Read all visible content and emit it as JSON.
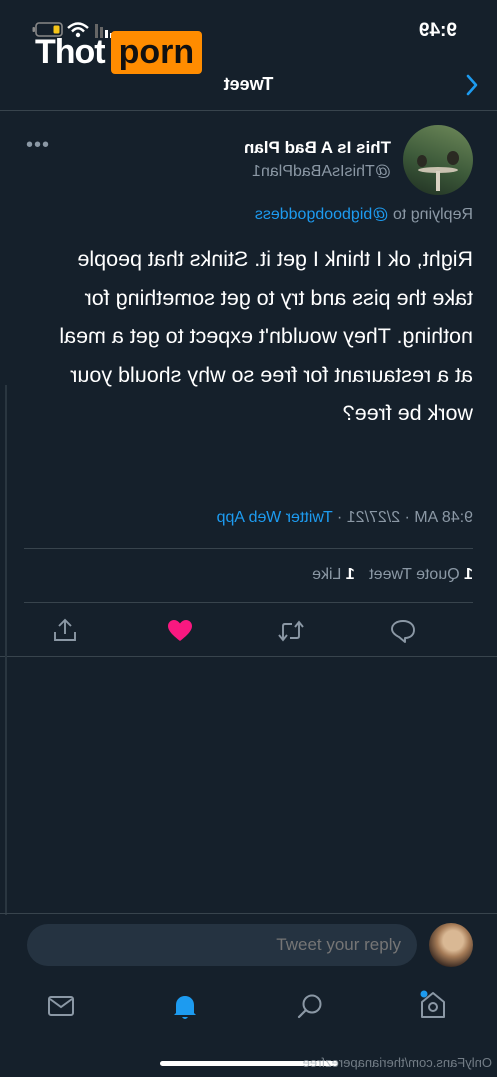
{
  "watermark": {
    "part1": "Thot",
    "part2": "porn"
  },
  "status_bar": {
    "time": "9:49"
  },
  "header": {
    "title": "Tweet"
  },
  "tweet": {
    "author_name": "This Is A Bad Plan",
    "author_handle": "@ThisIsABadPlan1",
    "replying_to_prefix": "Replying to",
    "replying_to_handle": "@bigboobgoddess",
    "text": "Right, ok I think I get it. Stinks that people take the piss and try to get something for nothing. They wouldn't expect to get a meal at a restaurant for free so why should your work be free?",
    "time": "9:48 AM · 2/27/21 ·",
    "source": "Twitter Web App",
    "quote_count": "1",
    "quote_label": "Quote Tweet",
    "like_count": "1",
    "like_label": "Like"
  },
  "reply_box": {
    "placeholder": "Tweet your reply"
  },
  "footer_text": "OnlyFans.com/therianaperezfree",
  "colors": {
    "background": "#15202b",
    "accent": "#1d9bf0",
    "like": "#f91880",
    "muted": "#8b98a5",
    "divider": "#38444d"
  },
  "icons": [
    "battery-icon",
    "wifi-icon",
    "signal-icon",
    "back-arrow-icon",
    "more-icon",
    "reply-icon",
    "retweet-icon",
    "like-icon",
    "share-icon",
    "home-icon",
    "search-icon",
    "notifications-icon",
    "messages-icon"
  ]
}
